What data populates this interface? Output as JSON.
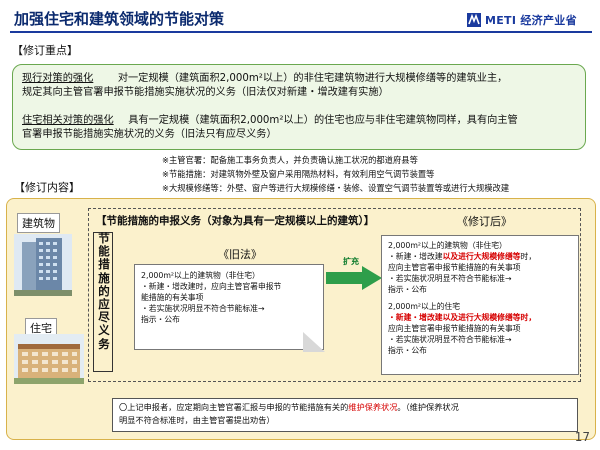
{
  "header": {
    "title": "加强住宅和建筑领域的节能对策",
    "logo_text": "METI 经济产业省"
  },
  "section1": {
    "label": "【修订重点】",
    "line1_head": "现行对策的强化",
    "line1_body": "对一定规模（建筑面积2,000m²以上）的非住宅建筑物进行大规模修缮等的建筑业主，",
    "line2": "规定其向主管官署申报节能措施实施状况的义务（旧法仅对新建・增改建有实施）",
    "line3_head": "住宅相关对策的强化",
    "line3_body": "具有一定规模（建筑面积2,000m²以上）的住宅也应与非住宅建筑物同样，具有向主管",
    "line4": "官署申报节能措施实施状况的义务（旧法只有应尽义务）"
  },
  "notes": [
    "※主管官署：配备施工事务负责人，并负责确认施工状况的都道府县等",
    "※节能措施：对建筑物外壁及窗户采用隔热材料，有效利用空气调节装置等",
    "※大规模修缮等：外壁、窗户等进行大规模修缮・装修、设置空气调节装置等或进行大规模改建"
  ],
  "section2": {
    "label": "【修订内容】",
    "tag_building": "建筑物",
    "tag_house": "住宅",
    "inner_title": "【节能措施的申报义务（对象为具有一定规模以上的建筑）】",
    "vertical": "节能措施的应尽义务",
    "old_label": "《旧法》",
    "new_label": "《修订后》",
    "arrow_label": "扩充",
    "old_box": [
      "2,000m²以上的建筑物（非住宅）",
      "・新建・增改建时，应向主管官署申报节",
      "能措施的有关事项",
      "・若实施状况明显不符合节能标准→",
      "指示・公布"
    ],
    "new_a_title": "2,000m²以上的建筑物（非住宅）",
    "new_a_l2a": "・新建・增改建",
    "new_a_l2b": "以及进行大规模修缮等",
    "new_a_l2c": "时，",
    "new_a_l3": "应向主管官署申报节能措施的有关事项",
    "new_a_l4": "・若实施状况明显不符合节能标准→",
    "new_a_l5": "指示・公布",
    "new_b_title": "2,000m²以上的住宅",
    "new_b_l2": "・新建・增改建以及进行大规模修缮等时，",
    "new_b_l3": "应向主管官署申报节能措施的有关事项",
    "new_b_l4": "・若实施状况明显不符合节能标准→",
    "new_b_l5": "指示・公布",
    "bottom_a": "〇上记申报者，应定期向主管官署汇报与申报的节能措施有关的",
    "bottom_red": "维护保养状况",
    "bottom_b": "。（维护保养状况",
    "bottom_c": "明显不符合标准时，由主管官署提出劝告）"
  },
  "page_number": "17",
  "colors": {
    "title_blue": "#0b2a6e",
    "accent_red": "#d60000",
    "green_fill": "#eef7e6",
    "yellow_fill": "#fbf1cc"
  }
}
